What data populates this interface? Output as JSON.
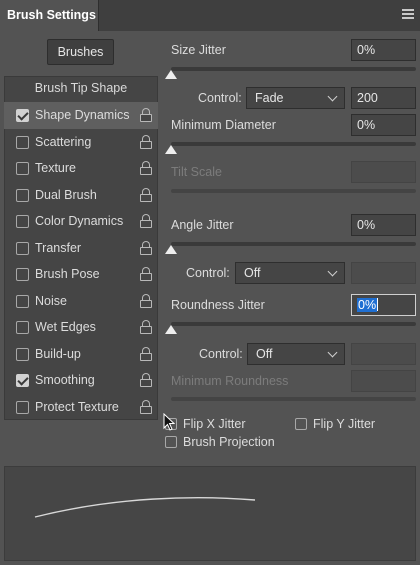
{
  "tab": {
    "title": "Brush Settings"
  },
  "brushes_button": "Brushes",
  "tip_shape_label": "Brush Tip Shape",
  "items": [
    {
      "label": "Shape Dynamics",
      "checked": true,
      "selected": true
    },
    {
      "label": "Scattering",
      "checked": false
    },
    {
      "label": "Texture",
      "checked": false
    },
    {
      "label": "Dual Brush",
      "checked": false
    },
    {
      "label": "Color Dynamics",
      "checked": false
    },
    {
      "label": "Transfer",
      "checked": false
    },
    {
      "label": "Brush Pose",
      "checked": false
    },
    {
      "label": "Noise",
      "checked": false
    },
    {
      "label": "Wet Edges",
      "checked": false
    },
    {
      "label": "Build-up",
      "checked": false
    },
    {
      "label": "Smoothing",
      "checked": true
    },
    {
      "label": "Protect Texture",
      "checked": false
    }
  ],
  "size_jitter": {
    "label": "Size Jitter",
    "value": "0%",
    "slider": 0
  },
  "control_size": {
    "label": "Control:",
    "value": "Fade",
    "fade_steps": "200"
  },
  "min_diameter": {
    "label": "Minimum Diameter",
    "value": "0%",
    "slider": 0
  },
  "tilt_scale": {
    "label": "Tilt Scale",
    "value": ""
  },
  "angle_jitter": {
    "label": "Angle Jitter",
    "value": "0%",
    "slider": 0
  },
  "control_angle": {
    "label": "Control:",
    "value": "Off"
  },
  "roundness_jitter": {
    "label": "Roundness Jitter",
    "value": "0%",
    "slider": 0
  },
  "control_roundness": {
    "label": "Control:",
    "value": "Off"
  },
  "min_roundness": {
    "label": "Minimum Roundness",
    "value": ""
  },
  "flip_x": {
    "label": "Flip X Jitter",
    "checked": false
  },
  "flip_y": {
    "label": "Flip Y Jitter",
    "checked": false
  },
  "brush_projection": {
    "label": "Brush Projection",
    "checked": false
  },
  "colors": {
    "panel": "#535353",
    "highlight": "#1f6fd2"
  }
}
